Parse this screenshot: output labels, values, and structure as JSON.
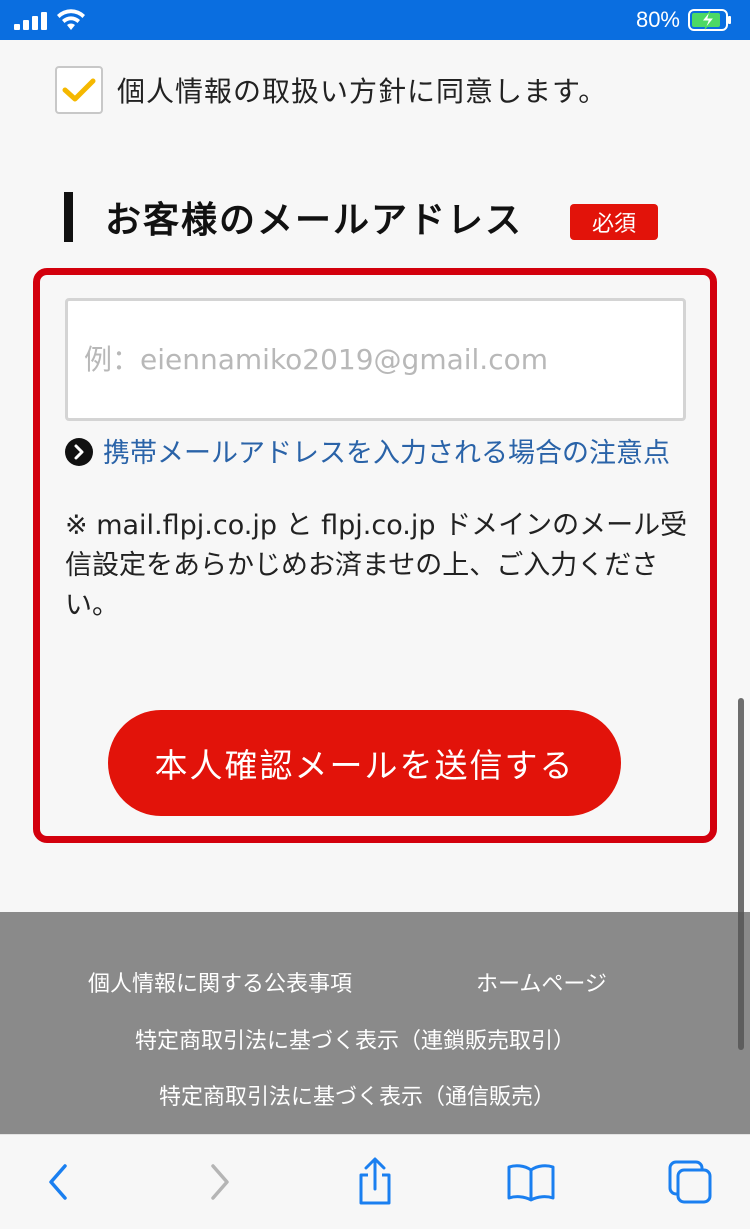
{
  "status_bar": {
    "battery_percent": "80%"
  },
  "agreement": {
    "checked": true,
    "label": "個人情報の取扱い方針に同意します。"
  },
  "email_section": {
    "title": "お客様のメールアドレス",
    "required_badge": "必須",
    "input_placeholder": "例：eiennamiko2019@gmail.com",
    "input_value": "",
    "note_link": "携帯メールアドレスを入力される場合の注意点",
    "note_text": "※ mail.flpj.co.jp と flpj.co.jp ドメインのメール受信設定をあらかじめお済ませの上、ご入力ください。",
    "send_button": "本人確認メールを送信する"
  },
  "footer": {
    "links": [
      "個人情報に関する公表事項",
      "ホームページ",
      "特定商取引法に基づく表示（連鎖販売取引）",
      "特定商取引法に基づく表示（通信販売）"
    ]
  },
  "toolbar": {
    "icons": [
      "back-icon",
      "forward-icon",
      "share-icon",
      "bookmarks-icon",
      "tabs-icon"
    ]
  },
  "colors": {
    "status_bar": "#0a6ee0",
    "accent_red": "#e2130a",
    "highlight_border": "#d3000d",
    "link_blue": "#2a63a8",
    "toolbar_blue": "#1a7ff0",
    "footer_gray": "#8a8a8a",
    "checkmark_yellow": "#f5b800"
  }
}
